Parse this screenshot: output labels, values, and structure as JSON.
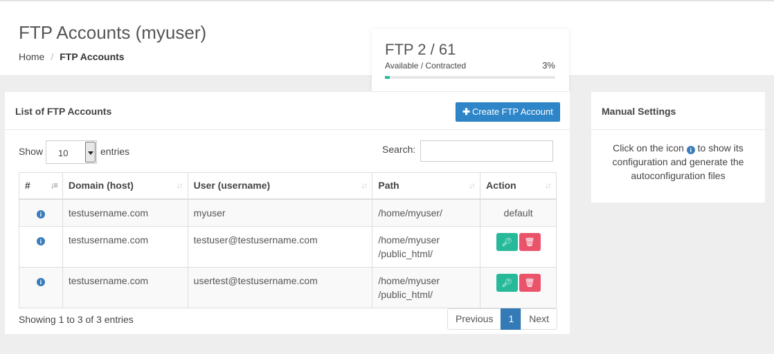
{
  "header": {
    "title": "FTP Accounts (myuser)",
    "breadcrumb": {
      "home": "Home",
      "separator": "/",
      "current": "FTP Accounts"
    }
  },
  "quota": {
    "title": "FTP 2 / 61",
    "subtitle": "Available / Contracted",
    "percent_label": "3%",
    "percent": 3,
    "color": "#26b99a"
  },
  "main": {
    "title": "List of FTP Accounts",
    "create_label": "Create FTP Account",
    "length": {
      "show": "Show",
      "value": "10",
      "entries": "entries"
    },
    "search_label": "Search:",
    "columns": [
      "#",
      "Domain (host)",
      "User (username)",
      "Path",
      "Action"
    ],
    "rows": [
      {
        "domain": "testusername.com",
        "user": "myuser",
        "path": "/home/myuser/",
        "path2": "",
        "action": "default"
      },
      {
        "domain": "testusername.com",
        "user": "testuser@testusername.com",
        "path": "/home/myuser",
        "path2": "/public_html/",
        "action": ""
      },
      {
        "domain": "testusername.com",
        "user": "usertest@testusername.com",
        "path": "/home/myuser",
        "path2": "/public_html/",
        "action": ""
      }
    ],
    "info": "Showing 1 to 3 of 3 entries",
    "pagination": {
      "previous": "Previous",
      "page": "1",
      "next": "Next"
    }
  },
  "side": {
    "title": "Manual Settings",
    "text_before": "Click on the icon",
    "text_after": "to show its configuration and generate the autoconfiguration files"
  },
  "colors": {
    "primary": "#2e86c9",
    "success": "#26b99a",
    "danger": "#e9546b",
    "info": "#3a7cbc"
  },
  "icons": {
    "info": "info-circle-icon",
    "key": "key-icon",
    "delete": "trash-icon",
    "sort": "sort-icon",
    "plus": "plus-icon"
  }
}
